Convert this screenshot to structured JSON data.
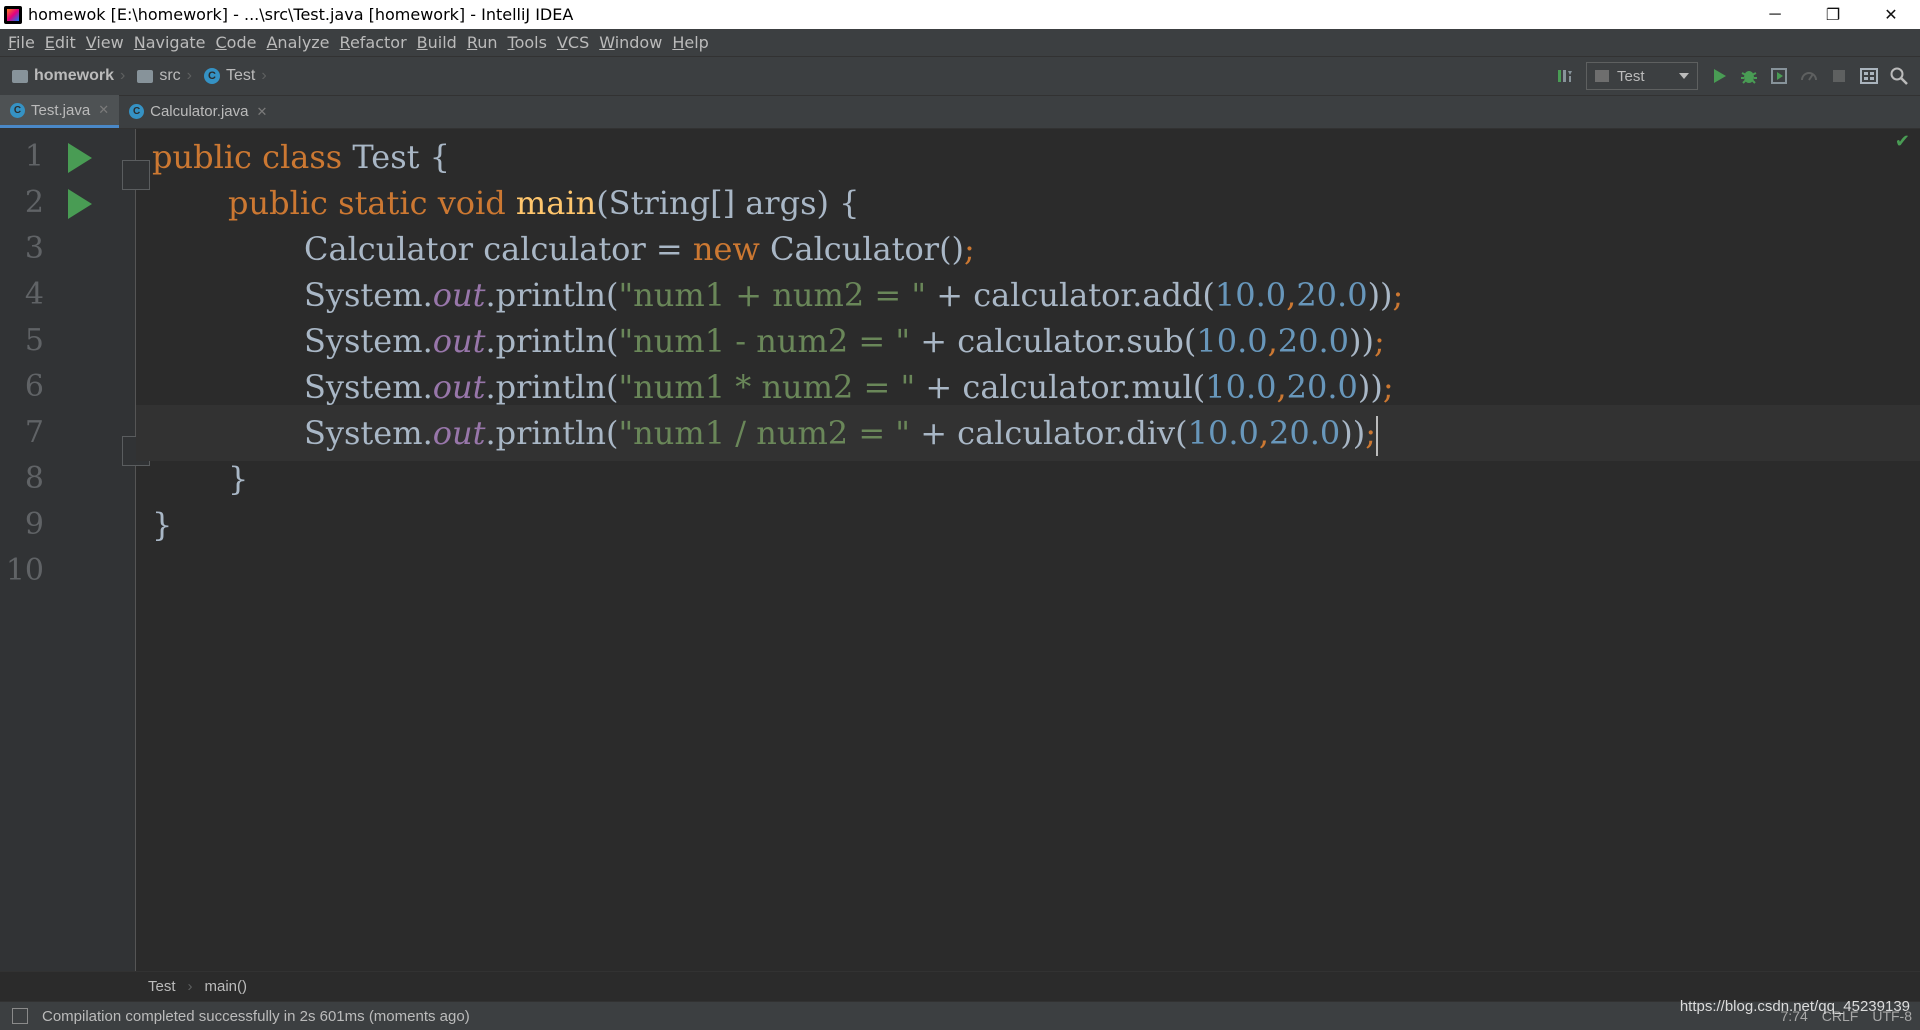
{
  "window": {
    "title": "homewok [E:\\homework] - ...\\src\\Test.java [homework] - IntelliJ IDEA",
    "controls": {
      "minimize": "─",
      "restore": "❐",
      "close": "✕"
    }
  },
  "menu": [
    "File",
    "Edit",
    "View",
    "Navigate",
    "Code",
    "Analyze",
    "Refactor",
    "Build",
    "Run",
    "Tools",
    "VCS",
    "Window",
    "Help"
  ],
  "navbar": {
    "project": "homework",
    "folder": "src",
    "file": "Test",
    "class_icon_letter": "C",
    "run_config": "Test"
  },
  "tabs": [
    {
      "label": "Test.java",
      "active": true
    },
    {
      "label": "Calculator.java",
      "active": false
    }
  ],
  "editor": {
    "line_numbers": [
      "1",
      "2",
      "3",
      "4",
      "5",
      "6",
      "7",
      "8",
      "9",
      "10"
    ],
    "lines": {
      "l1": {
        "kw1": "public",
        "kw2": "class",
        "name": "Test",
        "brace": "{"
      },
      "l2": {
        "kw1": "public",
        "kw2": "static",
        "kw3": "void",
        "fn": "main",
        "params": "(String[] args)",
        "brace": "{"
      },
      "l3": {
        "type": "Calculator",
        "var": "calculator",
        "eq": "=",
        "kw": "new",
        "ctor": "Calculator()",
        "semi": ";"
      },
      "l4": {
        "sys": "System.",
        "out": "out",
        "println": ".println(",
        "str": "\"num1 + num2 = \"",
        "plus": "+",
        "call": "calculator.add(",
        "n1": "10.0",
        "comma": ",",
        "n2": "20.0",
        "close": "))",
        "semi": ";"
      },
      "l5": {
        "sys": "System.",
        "out": "out",
        "println": ".println(",
        "str": "\"num1 - num2 = \"",
        "plus": "+",
        "call": "calculator.sub(",
        "n1": "10.0",
        "comma": ",",
        "n2": "20.0",
        "close": "))",
        "semi": ";"
      },
      "l6": {
        "sys": "System.",
        "out": "out",
        "println": ".println(",
        "str": "\"num1 * num2 = \"",
        "plus": "+",
        "call": "calculator.mul(",
        "n1": "10.0",
        "comma": ",",
        "n2": "20.0",
        "close": "))",
        "semi": ";"
      },
      "l7": {
        "sys": "System.",
        "out": "out",
        "println": ".println(",
        "str": "\"num1 / num2 = \"",
        "plus": "+",
        "call": "calculator.div(",
        "n1": "10.0",
        "comma": ",",
        "n2": "20.0",
        "close": "))",
        "semi": ";"
      },
      "l8": {
        "brace": "}"
      },
      "l9": {
        "brace": "}"
      }
    },
    "current_line": 7,
    "inspection_status": "✔"
  },
  "editor_breadcrumbs": [
    "Test",
    "main()"
  ],
  "status": {
    "message": "Compilation completed successfully in 2s 601ms (moments ago)",
    "position": "7:74",
    "line_sep": "CRLF",
    "encoding": "UTF-8"
  },
  "watermark": "https://blog.csdn.net/qq_45239139",
  "colors": {
    "keyword": "#cc7832",
    "function": "#ffc66d",
    "string": "#6a8759",
    "number": "#6897bb",
    "static_field": "#9876aa",
    "text": "#a9b7c6",
    "run_marker": "#499c54"
  }
}
